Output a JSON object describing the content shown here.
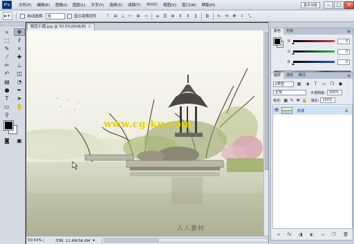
{
  "menubar": {
    "logo": "Ps",
    "items": [
      "文件(F)",
      "编辑(E)",
      "图像(I)",
      "图层(L)",
      "文字(Y)",
      "选择(S)",
      "滤镜(T)",
      "3D(D)",
      "视图(V)",
      "窗口(W)",
      "帮助(H)"
    ],
    "workspace": "基本功能",
    "min": "–",
    "max": "□",
    "close": "✕"
  },
  "options": {
    "tool_glyph": "▸+",
    "auto_select_label": "自动选择:",
    "auto_select_value": "组",
    "show_transform_label": "显示变换控件"
  },
  "document": {
    "tab_title": "桃花小镇.jpg @ 50.5%(RGB/8)",
    "tab_close": "×",
    "zoom": "50.63%",
    "size_label": "文档:",
    "size_value": "12.4M/56.6M",
    "status_arrow": "▸",
    "url_overlay": "www.cg-ku.com"
  },
  "color_panel": {
    "tabs": [
      "颜色",
      "色板"
    ],
    "menu": "≡",
    "channels": [
      {
        "name": "R",
        "value": "0",
        "color": "#d8343d"
      },
      {
        "name": "G",
        "value": "0",
        "color": "#2eb84b"
      },
      {
        "name": "B",
        "value": "0",
        "color": "#2c4fd8"
      }
    ]
  },
  "layers_panel": {
    "tabs": [
      "图层",
      "通道",
      "路径"
    ],
    "menu": "≡",
    "kind_label": "ρ类型",
    "blend_mode": "正常",
    "opacity_label": "不透明度:",
    "opacity_value": "100%",
    "lock_label": "锁定:",
    "fill_label": "填充:",
    "fill_value": "100%",
    "layers": [
      {
        "name": "背景",
        "visible": true,
        "locked": true
      }
    ],
    "footer_icons": [
      "∞",
      "fx",
      "◨",
      "◐",
      "▭",
      "❒",
      "🗑"
    ]
  },
  "watermark": "人人素材"
}
